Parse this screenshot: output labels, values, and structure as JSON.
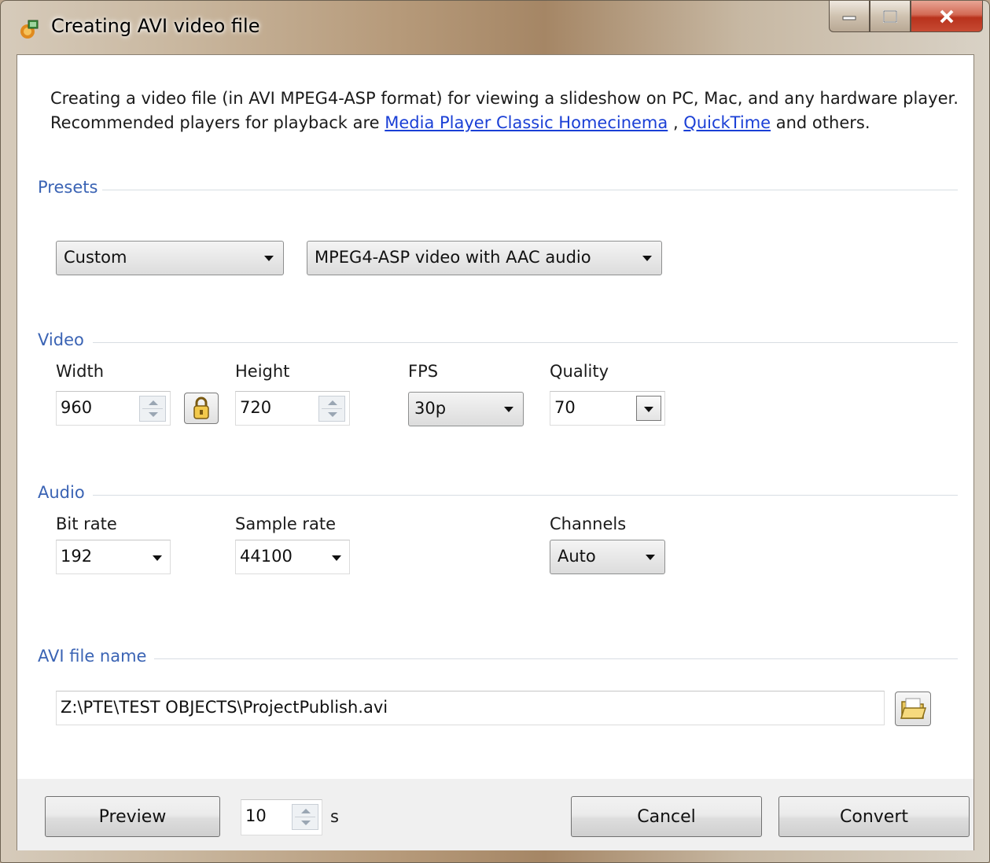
{
  "window": {
    "title": "Creating AVI video file",
    "app_icon": "pte-app-icon"
  },
  "description": {
    "text_before": "Creating a video file (in AVI MPEG4-ASP format) for viewing a slideshow on PC, Mac, and any hardware player. Recommended players for playback are ",
    "link1": "Media Player Classic Homecinema",
    "sep": " , ",
    "link2": "QuickTime",
    "text_after": " and others."
  },
  "presets": {
    "group_label": "Presets",
    "preset_value": "Custom",
    "format_value": "MPEG4-ASP video with AAC audio"
  },
  "video": {
    "group_label": "Video",
    "width_label": "Width",
    "width_value": "960",
    "height_label": "Height",
    "height_value": "720",
    "fps_label": "FPS",
    "fps_value": "30p",
    "quality_label": "Quality",
    "quality_value": "70"
  },
  "audio": {
    "group_label": "Audio",
    "bitrate_label": "Bit rate",
    "bitrate_value": "192",
    "samplerate_label": "Sample rate",
    "samplerate_value": "44100",
    "channels_label": "Channels",
    "channels_value": "Auto"
  },
  "file": {
    "group_label": "AVI file name",
    "path_value": "Z:\\PTE\\TEST OBJECTS\\ProjectPublish.avi"
  },
  "footer": {
    "preview_label": "Preview",
    "preview_seconds": "10",
    "seconds_unit": "s",
    "cancel_label": "Cancel",
    "convert_label": "Convert"
  },
  "colors": {
    "link": "#1a3fd6",
    "group_header": "#3a63b4",
    "close_button": "#c74a33"
  }
}
